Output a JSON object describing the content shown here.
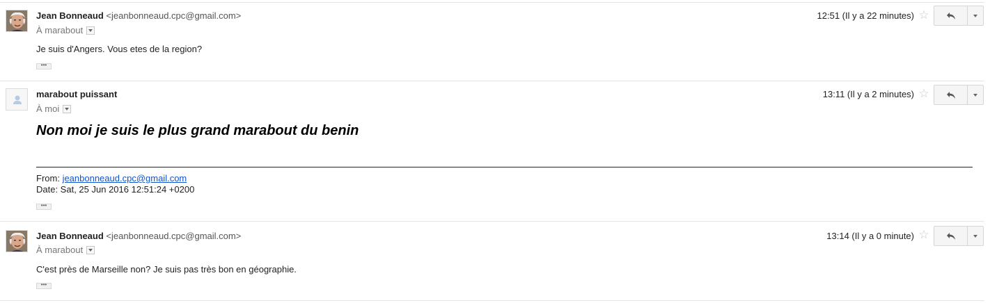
{
  "messages": [
    {
      "sender_name": "Jean Bonneaud",
      "sender_email": "<jeanbonneaud.cpc@gmail.com>",
      "recipient": "À marabout",
      "time": "12:51 (Il y a 22 minutes)",
      "body": "Je suis d'Angers. Vous etes de la region?"
    },
    {
      "sender_name": "marabout puissant",
      "sender_email": "",
      "recipient": "À moi",
      "time": "13:11 (Il y a 2 minutes)",
      "body": "Non moi je suis le plus grand marabout du benin",
      "quote_from_label": "From: ",
      "quote_from_value": "jeanbonneaud.cpc@gmail.com",
      "quote_date": "Date: Sat, 25 Jun 2016 12:51:24 +0200"
    },
    {
      "sender_name": "Jean Bonneaud",
      "sender_email": "<jeanbonneaud.cpc@gmail.com>",
      "recipient": "À marabout",
      "time": "13:14 (Il y a 0 minute)",
      "body": "C'est près de Marseille non? Je suis pas très bon en géographie."
    }
  ],
  "ellipsis": "•••",
  "icons": {
    "star": "star-icon",
    "reply": "reply-icon",
    "more": "chevron-down-icon",
    "avatar_photo": "avatar-photo",
    "avatar_default": "person-icon"
  }
}
